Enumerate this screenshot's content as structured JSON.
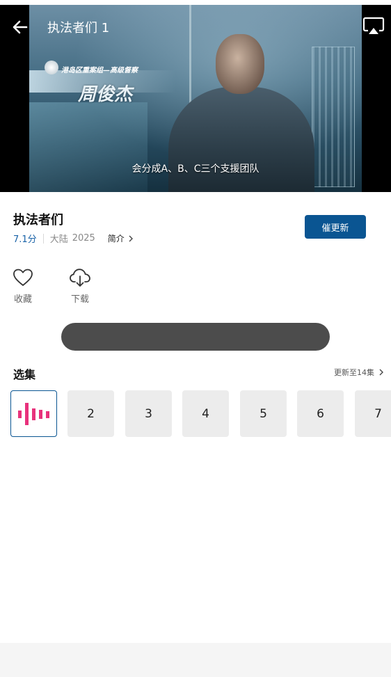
{
  "player": {
    "title": "执法者们 1",
    "subtitle": "会分成A、B、C三个支援团队",
    "caption_small": "港岛区重案组—高级督察",
    "caption_name": "周俊杰",
    "icons": {
      "back": "back-arrow-icon",
      "cast": "airplay-cast-icon"
    }
  },
  "show": {
    "title": "执法者们",
    "score": "7.1分",
    "region": "大陆",
    "year": "2025",
    "intro_label": "简介",
    "update_button": "催更新"
  },
  "actions": [
    {
      "label": "收藏",
      "icon": "heart-icon"
    },
    {
      "label": "下载",
      "icon": "cloud-download-icon"
    }
  ],
  "episodes": {
    "section_title": "选集",
    "update_info": "更新至14集",
    "items": [
      "2",
      "3",
      "4",
      "5",
      "6",
      "7"
    ],
    "active_icon": "playing-bars-icon"
  },
  "colors": {
    "accent": "#0a5592",
    "score": "#1a63a8",
    "playing": "#e8327c"
  }
}
